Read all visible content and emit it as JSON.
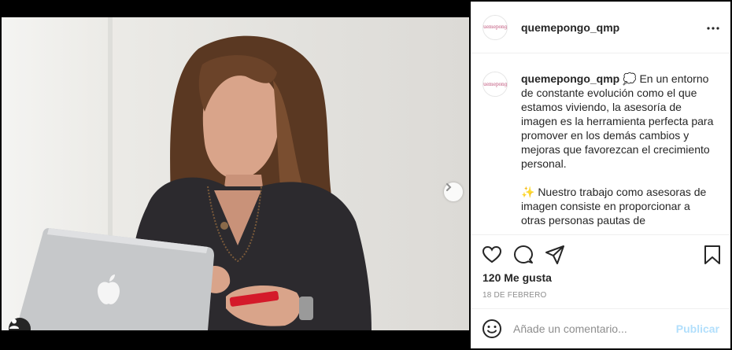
{
  "post": {
    "username": "quemepongo_qmp",
    "avatar_text": "quemepongo",
    "caption_paragraphs": [
      "En un entorno de constante evolución como el que estamos viviendo, la asesoría de imagen es la herramienta perfecta para promover en los demás cambios y mejoras que favorezcan el crecimiento personal.",
      "✨ Nuestro trabajo como asesoras de imagen consiste en proporcionar a otras personas pautas de"
    ],
    "caption_emoji": "💭",
    "likes_text": "120 Me gusta",
    "date_text": "18 de febrero",
    "carousel": {
      "slides": 2,
      "active_index": 0
    }
  },
  "comment": {
    "placeholder": "Añade un comentario...",
    "publish_label": "Publicar"
  },
  "icons": {
    "more": "more-horizontal-icon",
    "like": "heart-icon",
    "comment": "comment-icon",
    "share": "share-icon",
    "save": "bookmark-icon",
    "emoji": "emoji-icon",
    "next": "chevron-right-icon",
    "tag": "user-tag-icon"
  },
  "colors": {
    "link_blue": "#3897f0",
    "publish_disabled": "#b2dffc",
    "secondary_text": "#8e8e8e",
    "primary_text": "#262626"
  }
}
